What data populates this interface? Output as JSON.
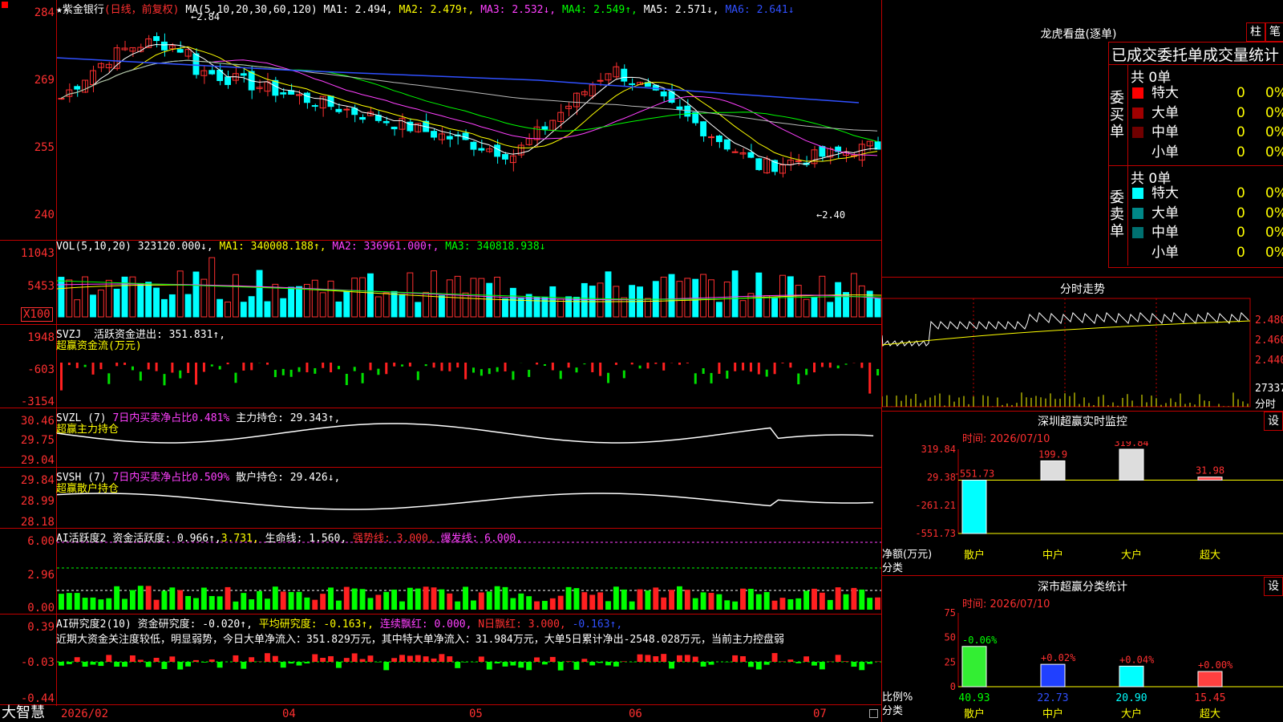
{
  "stock": {
    "name": "紫金银行",
    "mode": "(日线，前复权)"
  },
  "price_panel": {
    "ma_label": "MA(5,10,20,30,60,120)",
    "mas": [
      {
        "label": "MA1: 2.494",
        "arrow": ",",
        "color": "#ffffff"
      },
      {
        "label": "MA2: 2.479",
        "arrow": "↑,",
        "color": "#ffff00"
      },
      {
        "label": "MA3: 2.532",
        "arrow": "↓,",
        "color": "#ff40ff"
      },
      {
        "label": "MA4: 2.549",
        "arrow": "↑,",
        "color": "#00ff00"
      },
      {
        "label": "MA5: 2.571",
        "arrow": "↓,",
        "color": "#ffffff"
      },
      {
        "label": "MA6: 2.641",
        "arrow": "↓",
        "color": "#3050ff"
      }
    ],
    "yticks": [
      "284",
      "269",
      "255",
      "240"
    ],
    "high_note": "2.84",
    "low_note": "←2.40"
  },
  "vol_panel": {
    "title": "VOL(5,10,20)",
    "value": "323120.000↓,",
    "ma1": "MA1: 340008.188↑,",
    "ma2": "MA2: 336961.000↑,",
    "ma3": "MA3: 340818.938↓",
    "yticks": [
      "11043",
      "5453"
    ],
    "unit": "X100"
  },
  "svzj_panel": {
    "title": "SVZJ",
    "label": "活跃资金进出: 351.831↑,",
    "sub": "超赢资金流(万元)",
    "yticks": [
      "1948",
      "-603",
      "-3154"
    ]
  },
  "svzl_panel": {
    "title": "SVZL (7)",
    "label1": "7日内买卖净占比0.481%",
    "label2": "主力持仓: 29.343↑,",
    "sub": "超赢主力持仓",
    "yticks": [
      "30.46",
      "29.75",
      "29.04"
    ]
  },
  "svsh_panel": {
    "title": "SVSH (7)",
    "label1": "7日内买卖净占比0.509%",
    "label2": "散户持仓: 29.426↓,",
    "sub": "超赢散户持仓",
    "yticks": [
      "29.84",
      "28.99",
      "28.18"
    ]
  },
  "ai_active_panel": {
    "title": "AI活跃度2",
    "label1": "资金活跃度: 0.966↑,",
    "label2": "3.731,",
    "label3": "生命线: 1.560,",
    "label4": "强势线: 3.000,",
    "label5": "爆发线: 6.000,",
    "yticks": [
      "6.00",
      "2.96",
      "0.00"
    ]
  },
  "ai_research_panel": {
    "title": "AI研究度2(10)",
    "label1": "资金研究度: -0.020↑,",
    "label2": "平均研究度: -0.163↑,",
    "label3": "连续飘红: 0.000,",
    "label4": "N日飘红: 3.000,",
    "label5": "-0.163↑,",
    "comment": "近期大资金关注度较低，明显弱势，今日大单净流入：351.829万元，其中特大单净流入：31.984万元，大单5日累计净出-2548.028万元，当前主力控盘弱",
    "yticks": [
      "0.39",
      "-0.03",
      "-0.44"
    ]
  },
  "bottom_bar": {
    "brand": "大智慧",
    "dates": [
      "2026/02",
      "04",
      "05",
      "06",
      "07"
    ]
  },
  "right_panel": {
    "dragon": {
      "title": "龙虎看盘(逐单)",
      "btn1": "柱",
      "btn2": "笔"
    },
    "orders": {
      "header": "已成交委托单成交量统计",
      "buy_title": "委买单",
      "buy_total": "共 0单",
      "sell_title": "委卖单",
      "sell_total": "共 0单",
      "buy_rows": [
        {
          "label": "特大",
          "count": "0",
          "pct": "0%",
          "color": "#ff0000"
        },
        {
          "label": "大单",
          "count": "0",
          "pct": "0%",
          "color": "#a00000"
        },
        {
          "label": "中单",
          "count": "0",
          "pct": "0%",
          "color": "#700000"
        },
        {
          "label": "小单",
          "count": "0",
          "pct": "0%",
          "color": ""
        }
      ],
      "sell_rows": [
        {
          "label": "特大",
          "count": "0",
          "pct": "0%",
          "color": "#00ffff"
        },
        {
          "label": "大单",
          "count": "0",
          "pct": "0%",
          "color": "#008888"
        },
        {
          "label": "中单",
          "count": "0",
          "pct": "0%",
          "color": "#007070"
        },
        {
          "label": "小单",
          "count": "0",
          "pct": "0%",
          "color": ""
        }
      ]
    },
    "intraday": {
      "title": "分时走势",
      "yticks": [
        "2.480",
        "2.460",
        "2.440"
      ],
      "vol": "27337",
      "vol_unit": "分时"
    },
    "monitor": {
      "title": "深圳超赢实时监控",
      "btn": "设",
      "time": "时间: 2026/07/10",
      "yticks": [
        "319.84",
        "29.38",
        "-261.21",
        "-551.73"
      ],
      "ylabel1": "净额(万元)",
      "ylabel2": "分类",
      "bars": [
        {
          "cat": "散户",
          "value": "-551.73"
        },
        {
          "cat": "中户",
          "value": "199.9"
        },
        {
          "cat": "大户",
          "value": "319.84"
        },
        {
          "cat": "超大",
          "value": "31.98"
        }
      ]
    },
    "stats": {
      "title": "深市超赢分类统计",
      "btn": "设",
      "time": "时间: 2026/07/10",
      "yticks": [
        "75",
        "50",
        "25",
        "0"
      ],
      "ylabel1": "比例%",
      "ylabel2": "分类",
      "bars": [
        {
          "cat": "散户",
          "value": "40.93",
          "change": "-0.06%"
        },
        {
          "cat": "中户",
          "value": "22.73",
          "change": "+0.02%"
        },
        {
          "cat": "大户",
          "value": "20.90",
          "change": "+0.04%"
        },
        {
          "cat": "超大",
          "value": "15.45",
          "change": "+0.00%"
        }
      ]
    }
  },
  "chart_data": [
    {
      "type": "bar",
      "title": "深圳超赢实时监控",
      "categories": [
        "散户",
        "中户",
        "大户",
        "超大"
      ],
      "values": [
        -551.73,
        199.9,
        319.84,
        31.98
      ],
      "ylabel": "净额(万元)",
      "ylim": [
        -551.73,
        319.84
      ]
    },
    {
      "type": "bar",
      "title": "深市超赢分类统计",
      "categories": [
        "散户",
        "中户",
        "大户",
        "超大"
      ],
      "values": [
        40.93,
        22.73,
        20.9,
        15.45
      ],
      "ylabel": "比例%",
      "ylim": [
        0,
        75
      ]
    }
  ]
}
